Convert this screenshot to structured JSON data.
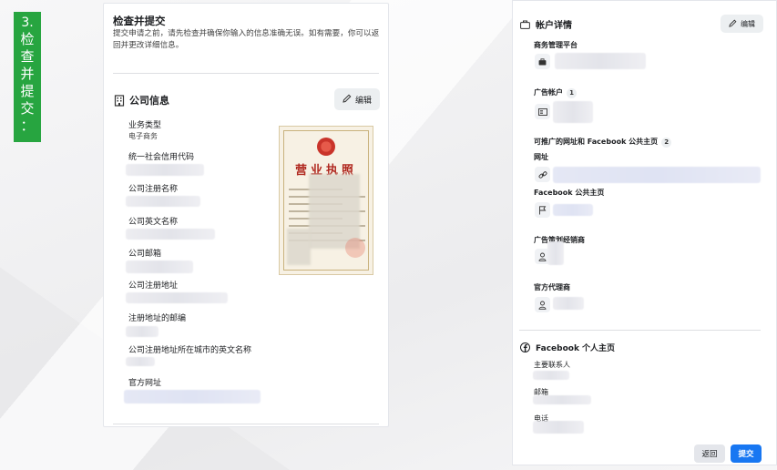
{
  "step_tag": {
    "num": "3.",
    "chars": [
      "检",
      "查",
      "并",
      "提",
      "交",
      "："
    ]
  },
  "left": {
    "title": "检查并提交",
    "description": "提交申请之前，请先检查并确保你输入的信息准确无误。如有需要，你可以返回并更改详细信息。",
    "section_title": "公司信息",
    "edit_label": "编辑",
    "fields": [
      {
        "label": "业务类型",
        "value": "电子商务"
      },
      {
        "label": "统一社会信用代码",
        "value": ""
      },
      {
        "label": "公司注册名称",
        "value": ""
      },
      {
        "label": "公司英文名称",
        "value": ""
      },
      {
        "label": "公司邮箱",
        "value": ""
      },
      {
        "label": "公司注册地址",
        "value": ""
      },
      {
        "label": "注册地址的邮编",
        "value": ""
      },
      {
        "label": "公司注册地址所在城市的英文名称",
        "value": ""
      },
      {
        "label": "官方网址",
        "value": ""
      }
    ],
    "license": {
      "title": "营业执照"
    }
  },
  "right": {
    "account_title": "帐户详情",
    "edit_label": "编辑",
    "business_manager": "商务管理平台",
    "ad_account": "广告帐户",
    "ad_account_count": "1",
    "promotable": "可推广的网址和 Facebook 公共主页",
    "promotable_count": "2",
    "url_label": "网址",
    "page_label": "Facebook 公共主页",
    "agency_label": "广告策划经销商",
    "official_agent": "官方代理商",
    "profile_title": "Facebook 个人主页",
    "primary_contact": "主要联系人",
    "email": "邮箱",
    "phone": "电话",
    "back_button": "返回",
    "submit_button": "提交"
  },
  "colors": {
    "step": "#27a540",
    "primary": "#1877f2"
  }
}
